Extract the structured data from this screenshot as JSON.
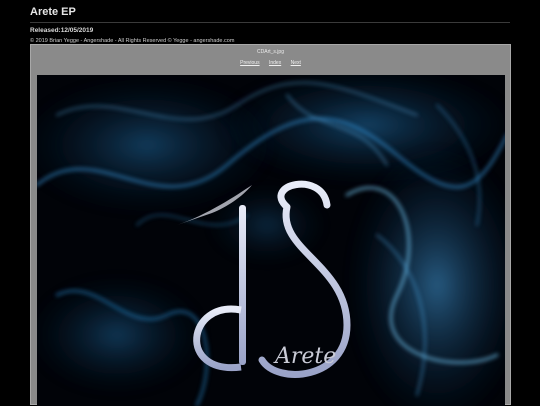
{
  "header": {
    "title": "Arete EP",
    "released": "Released:12/05/2019",
    "copyright": "© 2019 Brian Yegge - Angershade - All Rights Reserved © Yegge - angershade.com"
  },
  "viewer": {
    "filename": "CDArt_s.jpg",
    "nav": {
      "previous": "Previous",
      "index": "Index",
      "next": "Next"
    },
    "cover_text": "Arete",
    "colors": {
      "background": "#000000",
      "smoke": "#2a8fd6",
      "panel": "#8a8a8a"
    }
  }
}
